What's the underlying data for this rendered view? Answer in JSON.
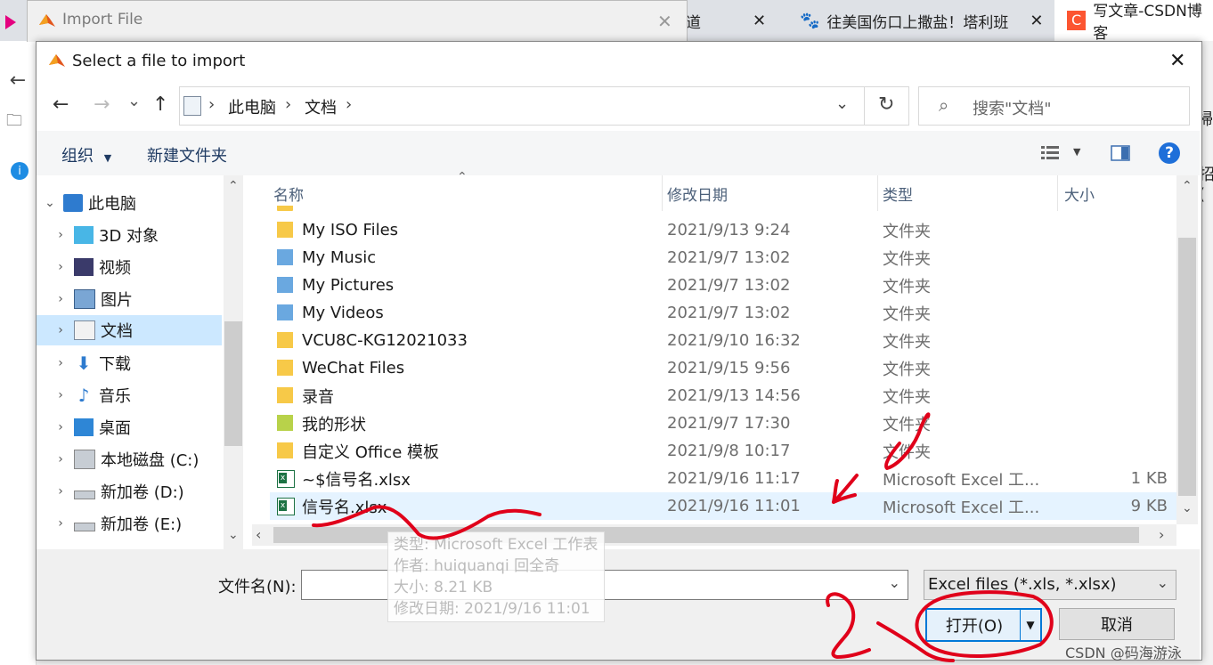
{
  "browser": {
    "tabs": [
      {
        "label": "道",
        "close": "✕"
      },
      {
        "label": "往美国伤口上撒盐！塔利班",
        "close": "✕"
      },
      {
        "label": "写文章-CSDN博客",
        "close": ""
      }
    ]
  },
  "outer_dialog": {
    "title": "Import File",
    "close": "✕"
  },
  "dialog": {
    "title": "Select a file to import",
    "close": "✕",
    "nav_back": "←",
    "nav_forward": "→",
    "nav_recent": "⌄",
    "nav_up": "↑",
    "breadcrumb": [
      "此电脑",
      "文档"
    ],
    "breadcrumb_sep": "›",
    "refresh": "↻",
    "search_placeholder": "搜索\"文档\"",
    "toolbar": {
      "organize": "组织",
      "new_folder": "新建文件夹",
      "help": "?"
    },
    "sidebar": [
      {
        "label": "此电脑",
        "icon": "computer-icon"
      },
      {
        "label": "3D 对象",
        "icon": "cube-icon"
      },
      {
        "label": "视频",
        "icon": "film-icon"
      },
      {
        "label": "图片",
        "icon": "picture-icon"
      },
      {
        "label": "文档",
        "icon": "document-icon",
        "selected": true
      },
      {
        "label": "下载",
        "icon": "download-icon"
      },
      {
        "label": "音乐",
        "icon": "music-icon"
      },
      {
        "label": "桌面",
        "icon": "desktop-icon"
      },
      {
        "label": "本地磁盘 (C:)",
        "icon": "drive-icon"
      },
      {
        "label": "新加卷 (D:)",
        "icon": "drive-icon"
      },
      {
        "label": "新加卷 (E:)",
        "icon": "drive-icon"
      }
    ],
    "columns": {
      "name": "名称",
      "date": "修改日期",
      "type": "类型",
      "size": "大小"
    },
    "files": [
      {
        "name": "My ISO Files",
        "date": "2021/9/13 9:24",
        "type": "文件夹",
        "size": "",
        "icon": "folder-icon"
      },
      {
        "name": "My Music",
        "date": "2021/9/7 13:02",
        "type": "文件夹",
        "size": "",
        "icon": "music-folder-icon"
      },
      {
        "name": "My Pictures",
        "date": "2021/9/7 13:02",
        "type": "文件夹",
        "size": "",
        "icon": "pictures-folder-icon"
      },
      {
        "name": "My Videos",
        "date": "2021/9/7 13:02",
        "type": "文件夹",
        "size": "",
        "icon": "videos-folder-icon"
      },
      {
        "name": "VCU8C-KG12021033",
        "date": "2021/9/10 16:32",
        "type": "文件夹",
        "size": "",
        "icon": "folder-icon"
      },
      {
        "name": "WeChat Files",
        "date": "2021/9/15 9:56",
        "type": "文件夹",
        "size": "",
        "icon": "folder-icon"
      },
      {
        "name": "录音",
        "date": "2021/9/13 14:56",
        "type": "文件夹",
        "size": "",
        "icon": "folder-icon"
      },
      {
        "name": "我的形状",
        "date": "2021/9/7 17:30",
        "type": "文件夹",
        "size": "",
        "icon": "shapes-folder-icon"
      },
      {
        "name": "自定义 Office 模板",
        "date": "2021/9/8 10:17",
        "type": "文件夹",
        "size": "",
        "icon": "folder-icon"
      },
      {
        "name": "~$信号名.xlsx",
        "date": "2021/9/16 11:17",
        "type": "Microsoft Excel 工...",
        "size": "1 KB",
        "icon": "excel-icon"
      },
      {
        "name": "信号名.xlsx",
        "date": "2021/9/16 11:01",
        "type": "Microsoft Excel 工...",
        "size": "9 KB",
        "icon": "excel-icon",
        "selected": true
      }
    ],
    "tooltip": [
      "类型: Microsoft Excel 工作表",
      "作者: huiquanqi 回全奇",
      "大小: 8.21 KB",
      "修改日期: 2021/9/16 11:01"
    ],
    "filename_label": "文件名(N):",
    "filename_value": "",
    "filter": "Excel files (*.xls, *.xlsx)",
    "open_button": "打开(O)",
    "cancel_button": "取消"
  },
  "watermark": "CSDN @码海游泳",
  "colors": {
    "selection": "#cce8ff",
    "row_selection": "#e5f3ff",
    "annotation": "#e0001a",
    "help": "#1e6fd9"
  }
}
